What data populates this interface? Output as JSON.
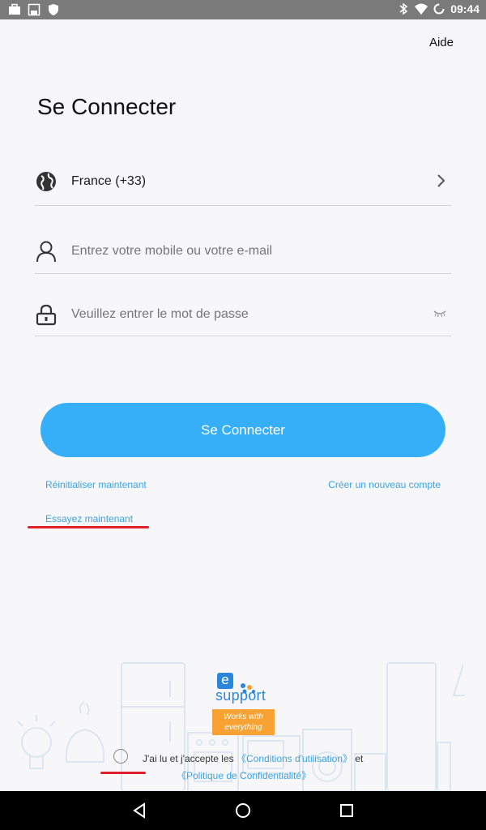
{
  "status_bar": {
    "time": "09:44",
    "left_icons": [
      "briefcase-icon",
      "save-icon",
      "shield-icon"
    ],
    "right_icons": [
      "bluetooth-icon",
      "wifi-icon",
      "sync-icon"
    ]
  },
  "header": {
    "help_label": "Aide"
  },
  "page": {
    "title": "Se Connecter"
  },
  "form": {
    "country_value": "France (+33)",
    "account_placeholder": "Entrez votre mobile ou votre e-mail",
    "password_placeholder": "Veuillez entrer le mot de passe"
  },
  "login_button": "Se Connecter",
  "links": {
    "reset": "Réinitialiser maintenant",
    "create": "Créer un nouveau compte",
    "try": "Essayez maintenant"
  },
  "logo": {
    "letter": "e",
    "word": "support",
    "tagline_1": "Works with",
    "tagline_2": "everything"
  },
  "agreement": {
    "prefix": "J'ai lu et j'accepte les ",
    "terms": "《Conditions d'utilisation》",
    "middle": " et",
    "privacy": "《Politique de Confidentialité》"
  },
  "colors": {
    "accent": "#36aef8",
    "link": "#3aa3e6",
    "annotation": "#e0212c",
    "logo_blue": "#2b86d9",
    "logo_orange": "#f7a233"
  }
}
